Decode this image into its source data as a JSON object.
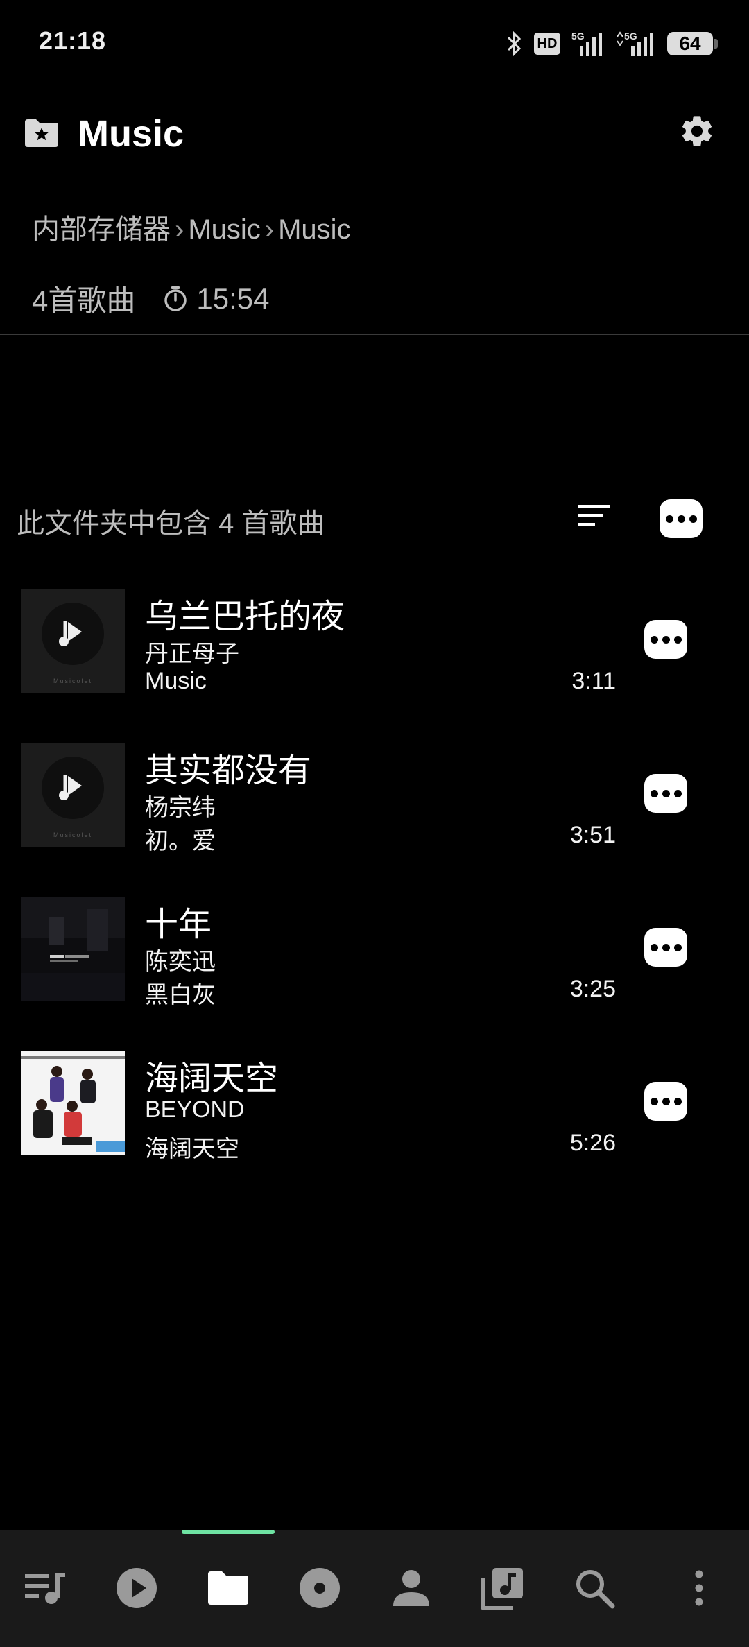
{
  "status_bar": {
    "time": "21:18",
    "hd_label": "HD",
    "network_1": "5G",
    "network_2": "5G",
    "battery": "64",
    "icons": [
      "bluetooth-icon",
      "hd-icon",
      "signal-icon",
      "signal-icon",
      "battery-icon"
    ]
  },
  "header": {
    "title": "Music",
    "folder_icon": "folder-star-icon",
    "settings_icon": "gear-icon"
  },
  "breadcrumb": [
    "内部存储器",
    "Music",
    "Music"
  ],
  "breadcrumb_separator": "›",
  "summary": {
    "song_count": "4首歌曲",
    "total_duration": "15:54"
  },
  "folder_info": {
    "text": "此文件夹中包含 4 首歌曲"
  },
  "songs": [
    {
      "title": "乌兰巴托的夜",
      "artist": "丹正母子",
      "album": "Music",
      "duration": "3:11",
      "art": "placeholder"
    },
    {
      "title": "其实都没有",
      "artist": "杨宗纬",
      "album": "初。爱",
      "duration": "3:51",
      "art": "placeholder"
    },
    {
      "title": "十年",
      "artist": "陈奕迅",
      "album": "黑白灰",
      "duration": "3:25",
      "art": "cover-dark"
    },
    {
      "title": "海阔天空",
      "artist": "BEYOND",
      "album": "海阔天空",
      "duration": "5:26",
      "art": "cover-beyond"
    }
  ],
  "bottom_nav": [
    {
      "name": "queue",
      "icon": "playlist-icon",
      "active": false
    },
    {
      "name": "now-playing",
      "icon": "play-circle-icon",
      "active": false
    },
    {
      "name": "folders",
      "icon": "folder-icon",
      "active": true
    },
    {
      "name": "albums",
      "icon": "disc-icon",
      "active": false
    },
    {
      "name": "artists",
      "icon": "person-icon",
      "active": false
    },
    {
      "name": "library",
      "icon": "music-library-icon",
      "active": false
    },
    {
      "name": "search",
      "icon": "search-icon",
      "active": false
    },
    {
      "name": "more",
      "icon": "more-vert-icon",
      "active": false
    }
  ],
  "colors": {
    "background": "#000000",
    "accent": "#6fe3a3",
    "secondary_text": "#bdbdbd",
    "nav_background": "#1a1a1a"
  }
}
